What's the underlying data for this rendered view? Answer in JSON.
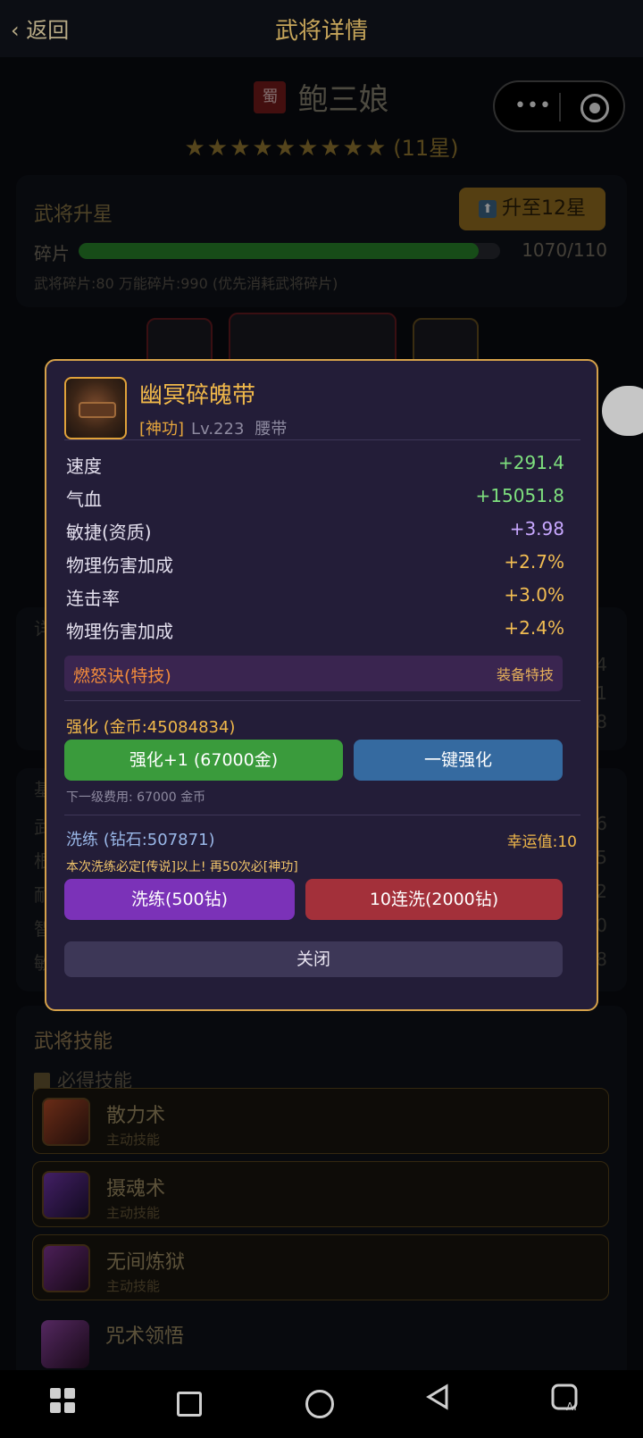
{
  "header": {
    "back_label": "‹ 返回",
    "title": "武将详情"
  },
  "hero": {
    "faction": "蜀",
    "name": "鲍三娘",
    "stars": "★★★★★★★★★",
    "star_text": "(11星)"
  },
  "upgrade": {
    "title": "武将升星",
    "button_label": "升至12星",
    "shard_label": "碎片",
    "shard_progress": 0.95,
    "shard_count": "1070/110",
    "shard_detail": "武将碎片:80  万能碎片:990 (优先消耗武将碎片)"
  },
  "popup": {
    "item_name": "幽冥碎魄带",
    "quality": "[神功]",
    "level": "Lv.223",
    "slot_type": "腰带",
    "stats": [
      {
        "name": "速度",
        "value": "+291.4",
        "color": "#7ee07e"
      },
      {
        "name": "气血",
        "value": "+15051.8",
        "color": "#7ee07e"
      },
      {
        "name": "敏捷(资质)",
        "value": "+3.98",
        "color": "#c8a8ff"
      },
      {
        "name": "物理伤害加成",
        "value": "+2.7%",
        "color": "#f2bd52"
      },
      {
        "name": "连击率",
        "value": "+3.0%",
        "color": "#f2bd52"
      },
      {
        "name": "物理伤害加成",
        "value": "+2.4%",
        "color": "#f2bd52"
      }
    ],
    "special_skill": "燃怒诀(特技)",
    "special_tag": "装备特技",
    "enhance_label": "强化 (金币:45084834)",
    "enhance_button": "强化+1 (67000金)",
    "auto_enhance_button": "一键强化",
    "next_cost": "下一级费用: 67000 金币",
    "refine_label": "洗练 (钻石:507871)",
    "luck": "幸运值:10",
    "refine_notice": "本次洗练必定[传说]以上! 再50次必[神功]",
    "refine_button": "洗练(500钻)",
    "refine10_button": "10连洗(2000钻)",
    "close_button": "关闭"
  },
  "skills": {
    "title": "武将技能",
    "section": "必得技能",
    "items": [
      {
        "name": "散力术",
        "type": "主动技能"
      },
      {
        "name": "摄魂术",
        "type": "主动技能"
      },
      {
        "name": "无间炼狱",
        "type": "主动技能"
      },
      {
        "name": "咒术领悟",
        "type": ""
      }
    ]
  },
  "background_fragments": {
    "side": [
      "详",
      "4",
      "1",
      "8"
    ],
    "base": [
      "基",
      "武",
      "6",
      "根",
      "5",
      "耐",
      "2",
      "智",
      "0",
      "敏",
      "8"
    ]
  },
  "colors": {
    "accent": "#d6a24a",
    "popup_bg": "#231d38",
    "green": "#7ee07e",
    "purple": "#c8a8ff",
    "gold": "#f2bd52"
  },
  "icons": [
    "back-chevron-icon",
    "more-dots-icon",
    "target-icon",
    "upgrade-arrow-icon",
    "book-icon",
    "apps-grid-icon",
    "home-square-icon",
    "home-circle-icon",
    "back-triangle-icon",
    "ai-icon"
  ]
}
